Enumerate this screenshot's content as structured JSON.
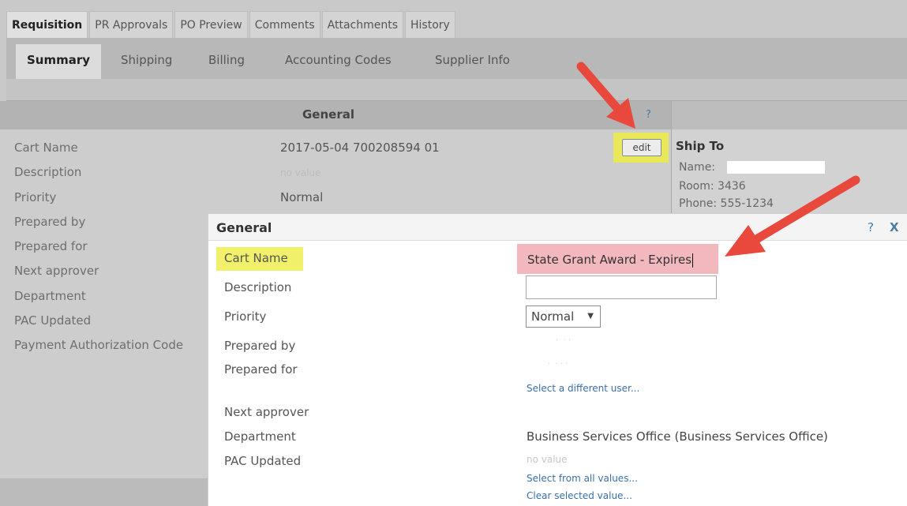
{
  "top_tabs": [
    "Requisition",
    "PR Approvals",
    "PO Preview",
    "Comments",
    "Attachments",
    "History"
  ],
  "sub_tabs": [
    "Summary",
    "Shipping",
    "Billing",
    "Accounting Codes",
    "Supplier Info"
  ],
  "general": {
    "title": "General",
    "help": "?",
    "edit_label": "edit",
    "labels": [
      "Cart Name",
      "Description",
      "Priority",
      "Prepared by",
      "Prepared for",
      "Next approver",
      "Department",
      "PAC Updated",
      "Payment Authorization Code"
    ],
    "cart_name": "2017-05-04 700208594 01",
    "description": "no value",
    "priority": "Normal"
  },
  "ship_to": {
    "title": "Ship To",
    "name_label": "Name:",
    "room": "Room: 3436",
    "phone": "Phone: 555-1234"
  },
  "modal": {
    "title": "General",
    "help": "?",
    "close": "X",
    "labels": {
      "cart_name": "Cart Name",
      "description": "Description",
      "priority": "Priority",
      "prepared_by": "Prepared by",
      "prepared_for": "Prepared for",
      "next_approver": "Next approver",
      "department": "Department",
      "pac_updated": "PAC Updated"
    },
    "cart_name_value": "State Grant Award - Expires",
    "description_value": "",
    "priority_value": "Normal",
    "select_user_link": "Select a different user...",
    "department_value": "Business Services Office (Business Services Office)",
    "pac_value": "no value",
    "select_all_link": "Select from all values...",
    "clear_link": "Clear selected value..."
  },
  "colors": {
    "highlight_yellow": "#f0f06a",
    "highlight_pink": "#f2b8bd",
    "arrow_red": "#e8493c",
    "link_blue": "#3a6fa8"
  }
}
